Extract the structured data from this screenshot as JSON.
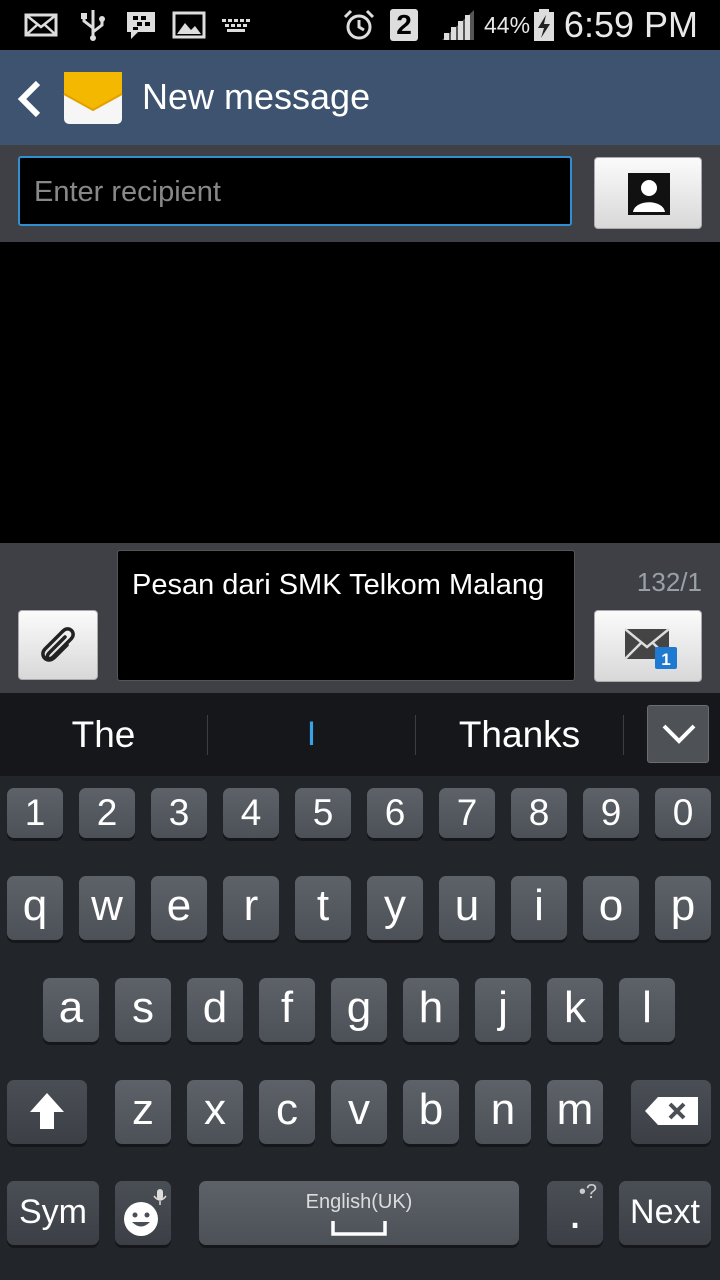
{
  "status_bar": {
    "icons": [
      "mail-icon",
      "usb-icon",
      "bbm-icon",
      "gallery-icon",
      "keyboard-icon",
      "alarm-icon",
      "sim2-icon",
      "signal-icon",
      "battery-charging-icon"
    ],
    "sim_label": "2",
    "battery_percent": "44%",
    "time": "6:59 PM"
  },
  "action_bar": {
    "title": "New message",
    "icons": [
      "back-arrow-icon",
      "messages-app-icon"
    ]
  },
  "recipient": {
    "placeholder": "Enter recipient",
    "contact_icon": "contact-person-icon"
  },
  "compose": {
    "message_text": "Pesan dari SMK Telkom Malang",
    "char_counter": "132/1",
    "attach_icon": "paperclip-icon",
    "send_icon": "send-mms-icon",
    "send_badge": "1"
  },
  "suggestions": {
    "left": "The",
    "middle": "I",
    "right": "Thanks",
    "expand_icon": "chevron-down-icon"
  },
  "keyboard": {
    "row_numbers": [
      "1",
      "2",
      "3",
      "4",
      "5",
      "6",
      "7",
      "8",
      "9",
      "0"
    ],
    "row_top": [
      "q",
      "w",
      "e",
      "r",
      "t",
      "y",
      "u",
      "i",
      "o",
      "p"
    ],
    "row_middle": [
      "a",
      "s",
      "d",
      "f",
      "g",
      "h",
      "j",
      "k",
      "l"
    ],
    "row_bottom": [
      "z",
      "x",
      "c",
      "v",
      "b",
      "n",
      "m"
    ],
    "sym_label": "Sym",
    "space_label": "English(UK)",
    "period_label": ".",
    "period_hint": "•?",
    "next_label": "Next",
    "shift_icon": "shift-arrow-icon",
    "backspace_icon": "backspace-icon",
    "emoji_icon": "emoji-mic-icon"
  },
  "colors": {
    "action_bar": "#3d5370",
    "focus_border": "#2f8fcf",
    "cursor_blue": "#3aa0e8",
    "key_face": "#555a61",
    "keyboard_bg": "#22252a"
  }
}
